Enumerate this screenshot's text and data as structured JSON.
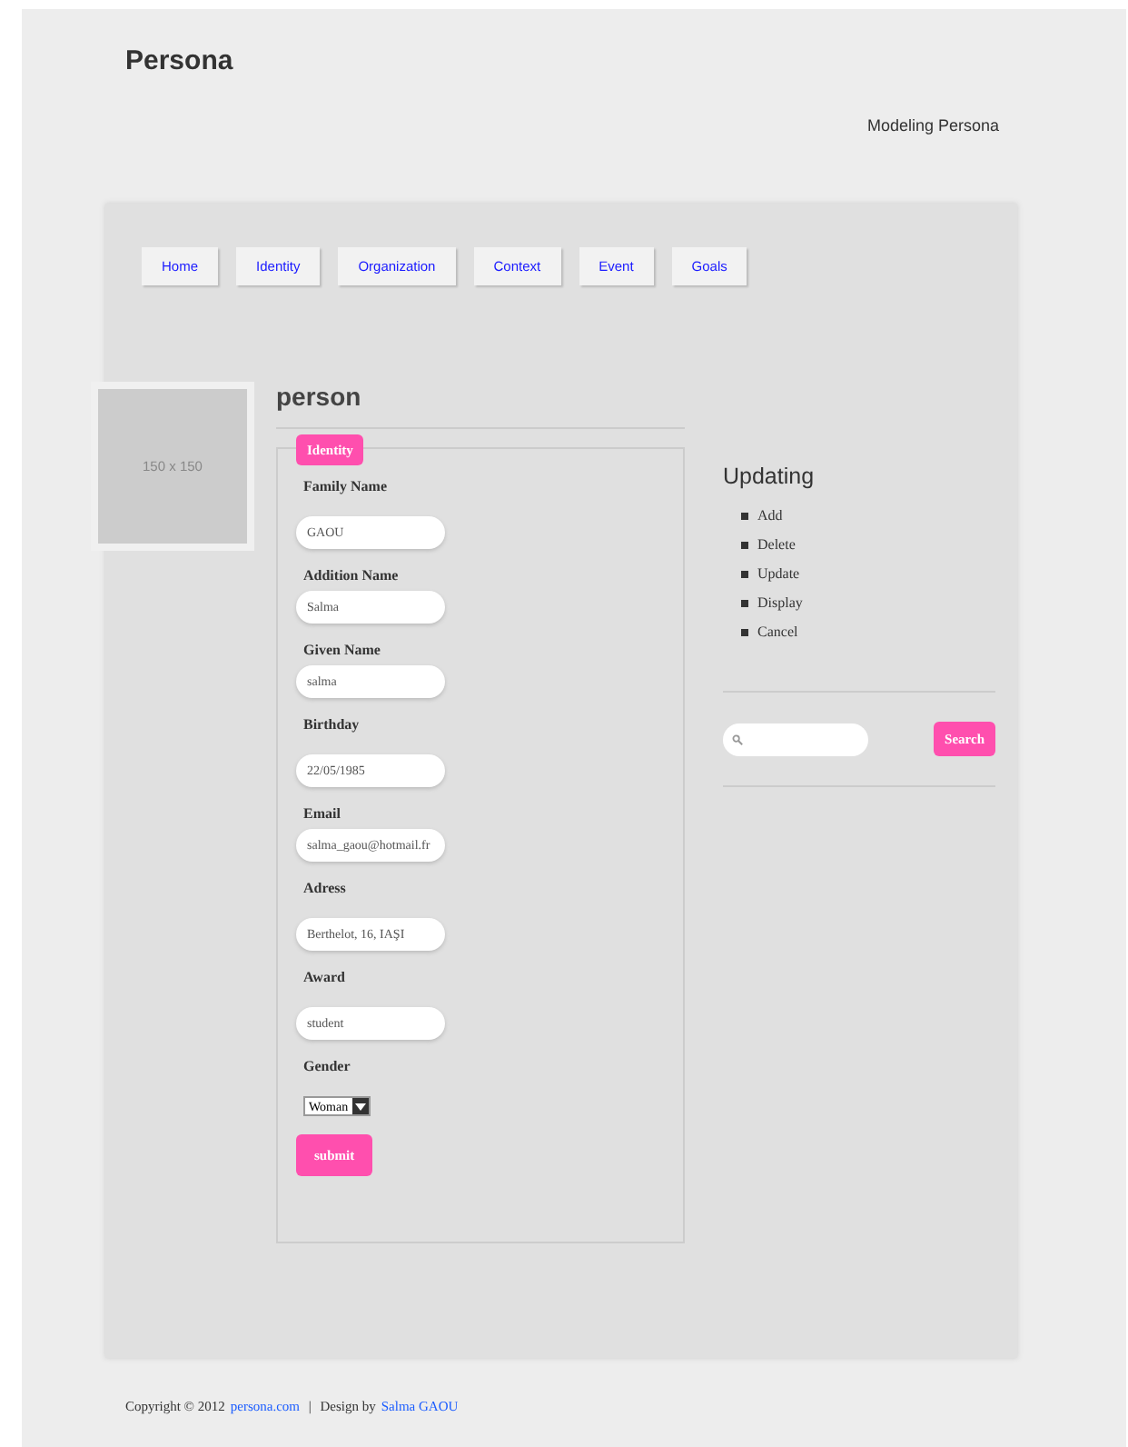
{
  "header": {
    "title": "Persona",
    "tagline": "Modeling Persona"
  },
  "nav": [
    {
      "label": "Home"
    },
    {
      "label": "Identity"
    },
    {
      "label": "Organization"
    },
    {
      "label": "Context"
    },
    {
      "label": "Event"
    },
    {
      "label": "Goals"
    }
  ],
  "placeholder_image": {
    "label": "150 x 150"
  },
  "content": {
    "heading": "person",
    "legend": "Identity",
    "fields": [
      {
        "kind": "text",
        "label": "Family Name",
        "value": "GAOU"
      },
      {
        "kind": "text",
        "label": "Addition Name",
        "value": "Salma"
      },
      {
        "kind": "text",
        "label": "Given Name",
        "value": "salma"
      },
      {
        "kind": "text",
        "label": "Birthday",
        "value": "22/05/1985"
      },
      {
        "kind": "text",
        "label": "Email",
        "value": "salma_gaou@hotmail.fr"
      },
      {
        "kind": "text",
        "label": "Adress",
        "value": "Berthelot, 16, IAŞI"
      },
      {
        "kind": "text",
        "label": "Award",
        "value": "student"
      },
      {
        "kind": "select",
        "label": "Gender",
        "value": "Woman"
      }
    ],
    "submit": "submit"
  },
  "sidebar": {
    "heading": "Updating",
    "items": [
      "Add",
      "Delete",
      "Update",
      "Display",
      "Cancel"
    ],
    "search_button": "Search"
  },
  "footer": {
    "copyright": "Copyright © 2012",
    "site_link": "persona.com",
    "separator": "|",
    "design_by": "Design by",
    "author_link": "Salma GAOU"
  }
}
